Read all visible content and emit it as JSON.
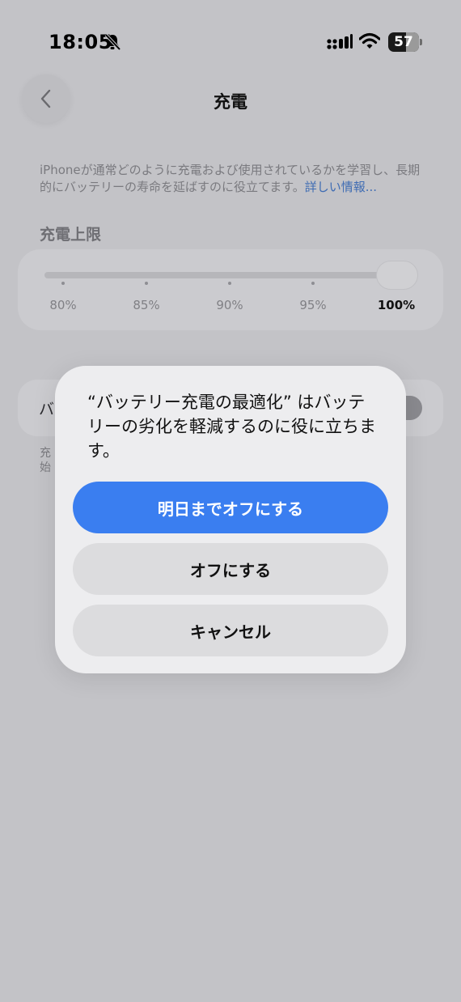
{
  "status_bar": {
    "time": "18:05",
    "battery": "57",
    "battery_level": 0.57,
    "icons": [
      "bell-slash-icon",
      "cellular-signal-icon",
      "wifi-icon",
      "battery-icon"
    ]
  },
  "nav": {
    "title": "充電",
    "back_icon": "chevron-left-icon"
  },
  "description": {
    "text": "iPhoneが通常どのように充電および使用されているかを学習し、長期的にバッテリーの寿命を延ばすのに役立てます。",
    "link": "詳しい情報..."
  },
  "charge_limit": {
    "header": "充電上限",
    "ticks": [
      "80%",
      "85%",
      "90%",
      "95%",
      "100%"
    ],
    "selected": "100%"
  },
  "optimization_row": {
    "label": "バ",
    "footer_line1": "充",
    "footer_line2": "始"
  },
  "dialog": {
    "message": "“バッテリー充電の最適化” はバッテリーの劣化を軽減するのに役に立ちます。",
    "buttons": {
      "primary": "明日までオフにする",
      "off": "オフにする",
      "cancel": "キャンセル"
    }
  },
  "colors": {
    "accent": "#3a7ef0",
    "link": "#3f6cb3",
    "background": "#c3c3c7"
  }
}
